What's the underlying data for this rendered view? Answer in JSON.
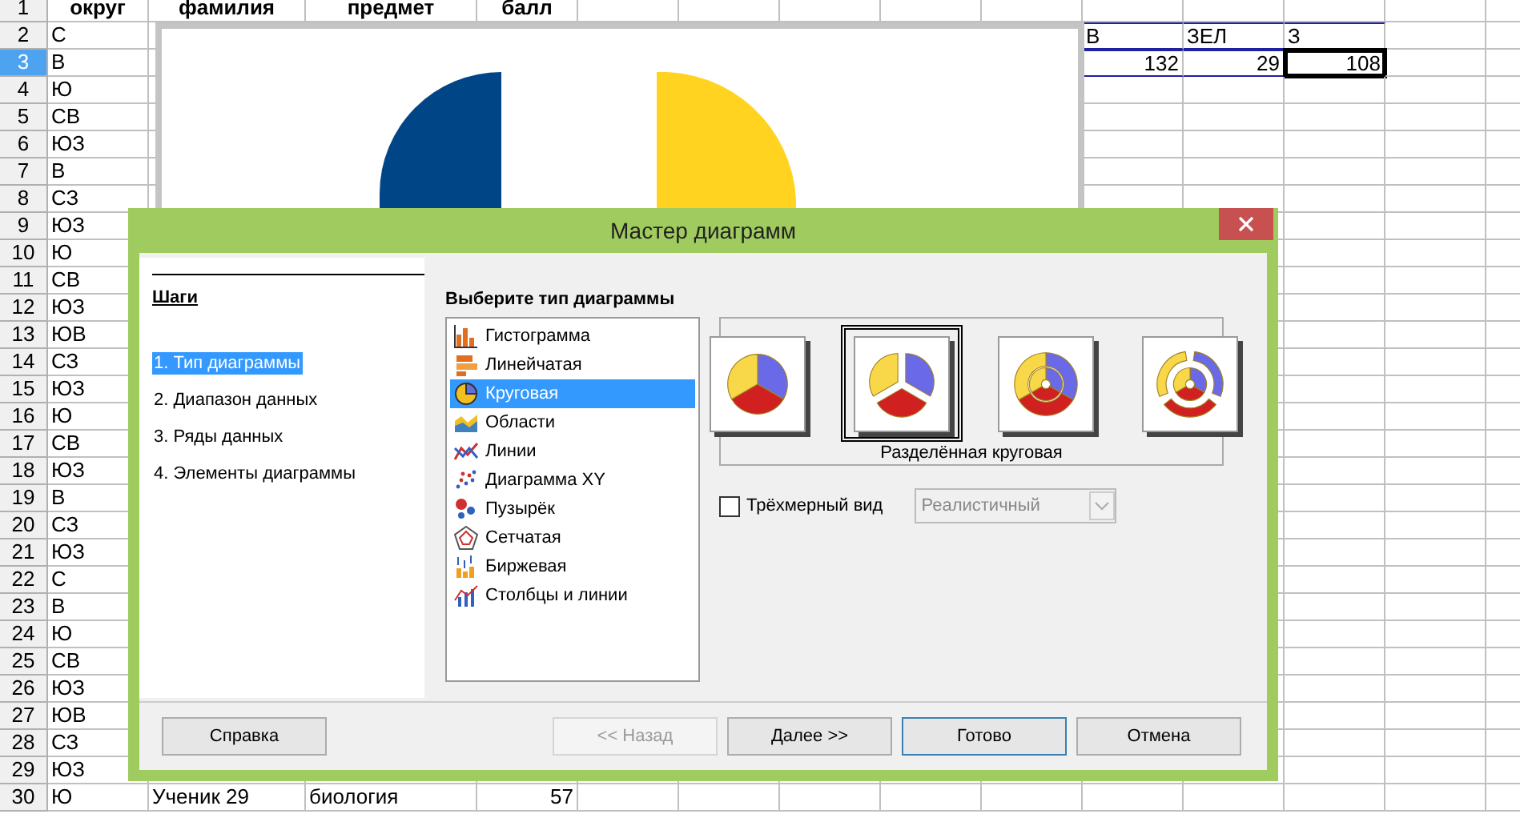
{
  "sheet": {
    "rows": [
      {
        "number": "1",
        "selected": false,
        "cells": [
          {
            "text": "округ",
            "kind": "header"
          },
          {
            "text": "фамилия",
            "kind": "header"
          },
          {
            "text": "предмет",
            "kind": "header"
          },
          {
            "text": "балл",
            "kind": "header"
          }
        ]
      },
      {
        "number": "2",
        "selected": false,
        "cells": [
          {
            "text": "С",
            "kind": "text"
          },
          null,
          null,
          null,
          null,
          null,
          null,
          null,
          null,
          {
            "text": "В",
            "kind": "text",
            "in_range": true,
            "selected": false
          },
          {
            "text": "ЗЕЛ",
            "kind": "text",
            "in_range": true,
            "selected": false
          },
          {
            "text": "З",
            "kind": "text",
            "in_range": true,
            "selected": false
          }
        ]
      },
      {
        "number": "3",
        "selected": true,
        "cells": [
          {
            "text": "В",
            "kind": "text"
          },
          null,
          null,
          null,
          null,
          null,
          null,
          null,
          null,
          {
            "text": "132",
            "kind": "number",
            "in_range": true,
            "selected": false
          },
          {
            "text": "29",
            "kind": "number",
            "in_range": true,
            "selected": false
          },
          {
            "text": "108",
            "kind": "number",
            "in_range": true,
            "selected": true
          }
        ]
      },
      {
        "number": "4",
        "selected": false,
        "cells": [
          {
            "text": "Ю",
            "kind": "text"
          }
        ]
      },
      {
        "number": "5",
        "selected": false,
        "cells": [
          {
            "text": "СВ",
            "kind": "text"
          }
        ]
      },
      {
        "number": "6",
        "selected": false,
        "cells": [
          {
            "text": "ЮЗ",
            "kind": "text"
          }
        ]
      },
      {
        "number": "7",
        "selected": false,
        "cells": [
          {
            "text": "В",
            "kind": "text"
          }
        ]
      },
      {
        "number": "8",
        "selected": false,
        "cells": [
          {
            "text": "СЗ",
            "kind": "text"
          }
        ]
      },
      {
        "number": "9",
        "selected": false,
        "cells": [
          {
            "text": "ЮЗ",
            "kind": "text"
          }
        ]
      },
      {
        "number": "10",
        "selected": false,
        "cells": [
          {
            "text": "Ю",
            "kind": "text"
          }
        ]
      },
      {
        "number": "11",
        "selected": false,
        "cells": [
          {
            "text": "СВ",
            "kind": "text"
          }
        ]
      },
      {
        "number": "12",
        "selected": false,
        "cells": [
          {
            "text": "ЮЗ",
            "kind": "text"
          }
        ]
      },
      {
        "number": "13",
        "selected": false,
        "cells": [
          {
            "text": "ЮВ",
            "kind": "text"
          }
        ]
      },
      {
        "number": "14",
        "selected": false,
        "cells": [
          {
            "text": "СЗ",
            "kind": "text"
          }
        ]
      },
      {
        "number": "15",
        "selected": false,
        "cells": [
          {
            "text": "ЮЗ",
            "kind": "text"
          }
        ]
      },
      {
        "number": "16",
        "selected": false,
        "cells": [
          {
            "text": "Ю",
            "kind": "text"
          }
        ]
      },
      {
        "number": "17",
        "selected": false,
        "cells": [
          {
            "text": "СВ",
            "kind": "text"
          }
        ]
      },
      {
        "number": "18",
        "selected": false,
        "cells": [
          {
            "text": "ЮЗ",
            "kind": "text"
          }
        ]
      },
      {
        "number": "19",
        "selected": false,
        "cells": [
          {
            "text": "В",
            "kind": "text"
          }
        ]
      },
      {
        "number": "20",
        "selected": false,
        "cells": [
          {
            "text": "СЗ",
            "kind": "text"
          }
        ]
      },
      {
        "number": "21",
        "selected": false,
        "cells": [
          {
            "text": "ЮЗ",
            "kind": "text"
          }
        ]
      },
      {
        "number": "22",
        "selected": false,
        "cells": [
          {
            "text": "С",
            "kind": "text"
          }
        ]
      },
      {
        "number": "23",
        "selected": false,
        "cells": [
          {
            "text": "В",
            "kind": "text"
          }
        ]
      },
      {
        "number": "24",
        "selected": false,
        "cells": [
          {
            "text": "Ю",
            "kind": "text"
          }
        ]
      },
      {
        "number": "25",
        "selected": false,
        "cells": [
          {
            "text": "СВ",
            "kind": "text"
          }
        ]
      },
      {
        "number": "26",
        "selected": false,
        "cells": [
          {
            "text": "ЮЗ",
            "kind": "text"
          }
        ]
      },
      {
        "number": "27",
        "selected": false,
        "cells": [
          {
            "text": "ЮВ",
            "kind": "text"
          }
        ]
      },
      {
        "number": "28",
        "selected": false,
        "cells": [
          {
            "text": "СЗ",
            "kind": "text"
          }
        ]
      },
      {
        "number": "29",
        "selected": false,
        "cells": [
          {
            "text": "ЮЗ",
            "kind": "text"
          }
        ]
      },
      {
        "number": "30",
        "selected": false,
        "cells": [
          {
            "text": "Ю",
            "kind": "text"
          },
          {
            "text": "Ученик 29",
            "kind": "text"
          },
          {
            "text": "биология",
            "kind": "text"
          },
          {
            "text": "57",
            "kind": "number"
          }
        ]
      }
    ]
  },
  "dialog": {
    "title": "Мастер диаграмм",
    "steps_title": "Шаги",
    "steps": [
      {
        "label": "1. Тип диаграммы",
        "selected": true
      },
      {
        "label": "2. Диапазон данных",
        "selected": false
      },
      {
        "label": "3. Ряды данных",
        "selected": false
      },
      {
        "label": "4. Элементы диаграммы",
        "selected": false
      }
    ],
    "chart_type_title": "Выберите тип диаграммы",
    "chart_types": [
      {
        "label": "Гистограмма",
        "kind": "column",
        "selected": false
      },
      {
        "label": "Линейчатая",
        "kind": "bar",
        "selected": false
      },
      {
        "label": "Круговая",
        "kind": "pie",
        "selected": true
      },
      {
        "label": "Области",
        "kind": "area",
        "selected": false
      },
      {
        "label": "Линии",
        "kind": "line",
        "selected": false
      },
      {
        "label": "Диаграмма XY",
        "kind": "xy",
        "selected": false
      },
      {
        "label": "Пузырёк",
        "kind": "bubble",
        "selected": false
      },
      {
        "label": "Сетчатая",
        "kind": "net",
        "selected": false
      },
      {
        "label": "Биржевая",
        "kind": "stock",
        "selected": false
      },
      {
        "label": "Столбцы и линии",
        "kind": "combo",
        "selected": false
      }
    ],
    "variants": [
      {
        "kind": "pie",
        "selected": false
      },
      {
        "kind": "exploded",
        "selected": true
      },
      {
        "kind": "donut",
        "selected": false
      },
      {
        "kind": "exploded-donut",
        "selected": false
      }
    ],
    "variant_label": "Разделённая круговая",
    "three_d": {
      "label": "Трёхмерный вид",
      "checked": false
    },
    "style_dropdown": {
      "value": "Реалистичный",
      "disabled": true
    },
    "buttons": [
      {
        "label": "Справка",
        "disabled": false,
        "default": false
      },
      {
        "label": "<< Назад",
        "disabled": true,
        "default": false
      },
      {
        "label": "Далее >>",
        "disabled": false,
        "default": false
      },
      {
        "label": "Готово",
        "disabled": false,
        "default": true
      },
      {
        "label": "Отмена",
        "disabled": false,
        "default": false
      }
    ]
  }
}
